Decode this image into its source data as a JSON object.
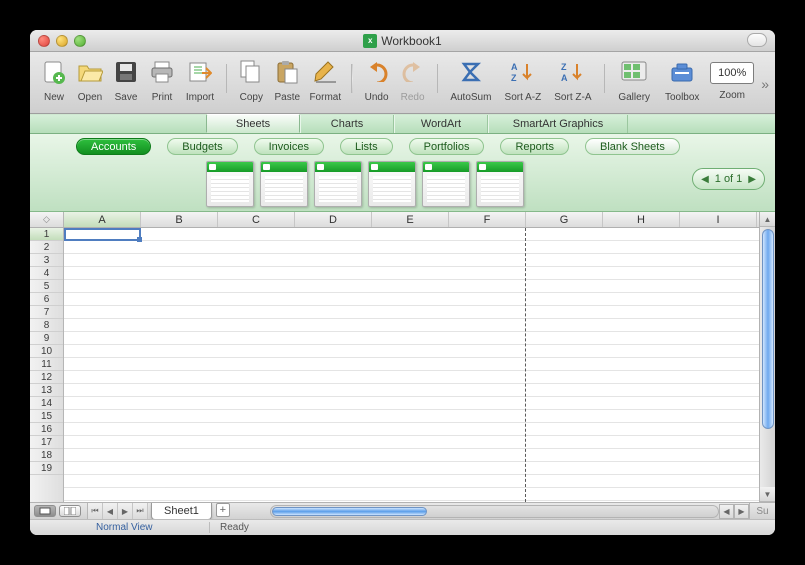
{
  "title": "Workbook1",
  "toolbar": {
    "new": "New",
    "open": "Open",
    "save": "Save",
    "print": "Print",
    "import": "Import",
    "copy": "Copy",
    "paste": "Paste",
    "format": "Format",
    "undo": "Undo",
    "redo": "Redo",
    "autosum": "AutoSum",
    "sortaz": "Sort A-Z",
    "sortza": "Sort Z-A",
    "gallery": "Gallery",
    "toolbox": "Toolbox",
    "zoom_label": "Zoom",
    "zoom_value": "100%"
  },
  "ribbon": {
    "tabs": [
      "Sheets",
      "Charts",
      "WordArt",
      "SmartArt Graphics"
    ],
    "active": 0
  },
  "gallery": {
    "categories": [
      "Accounts",
      "Budgets",
      "Invoices",
      "Lists",
      "Portfolios",
      "Reports",
      "Blank Sheets"
    ],
    "active": 0,
    "templates_count": 6,
    "pager": "1 of 1"
  },
  "grid": {
    "columns": [
      "A",
      "B",
      "C",
      "D",
      "E",
      "F",
      "G",
      "H",
      "I"
    ],
    "rows": [
      1,
      2,
      3,
      4,
      5,
      6,
      7,
      8,
      9,
      10,
      11,
      12,
      13,
      14,
      15,
      16,
      17,
      18,
      19
    ],
    "active_cell": {
      "col": "A",
      "row": 1
    }
  },
  "sheets": {
    "tabs": [
      "Sheet1"
    ],
    "active": 0
  },
  "status": {
    "view": "Normal View",
    "msg": "Ready",
    "sum_label": "Su"
  }
}
